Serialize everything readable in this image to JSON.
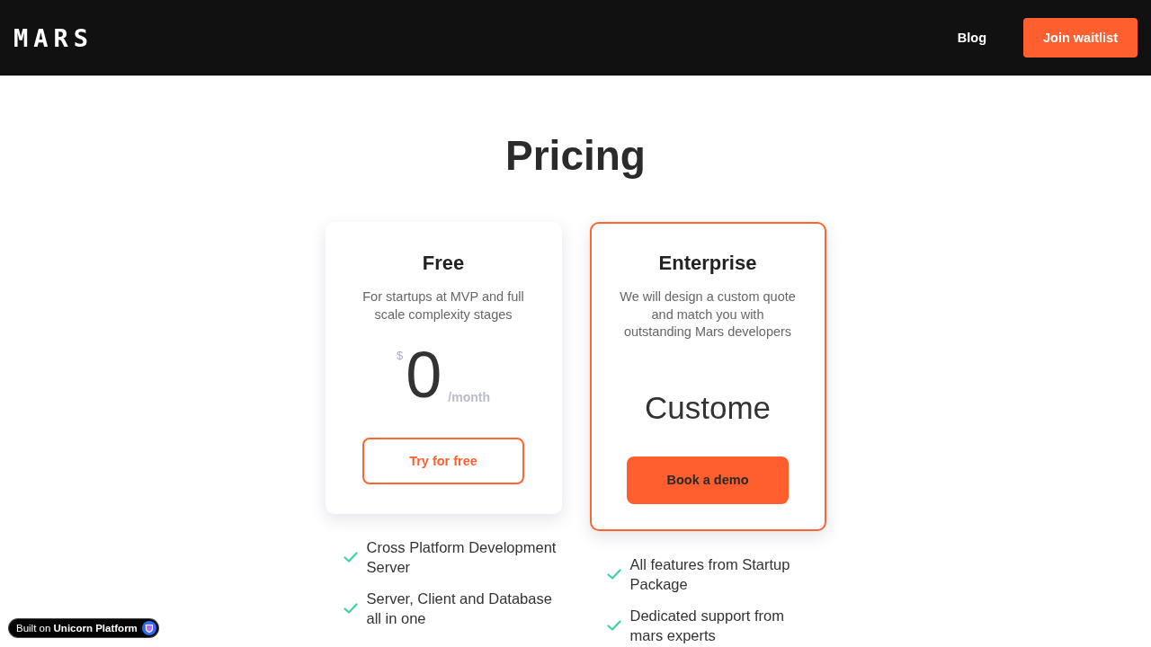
{
  "header": {
    "logo": "MARS",
    "nav": [
      "Blog"
    ],
    "cta": "Join waitlist"
  },
  "title": "Pricing",
  "plans": [
    {
      "kind": "price",
      "highlighted": false,
      "name": "Free",
      "description": "For startups at MVP and full scale complexity stages",
      "currency": "$",
      "price": "0",
      "period": "/month",
      "button": {
        "kind": "outline",
        "label": "Try for free"
      },
      "features": [
        "Cross Platform Development Server",
        "Server, Client and Database all in one"
      ]
    },
    {
      "kind": "custom",
      "highlighted": true,
      "name": "Enterprise",
      "description": "We will design a custom quote and match you with outstanding Mars developers",
      "price": "Custome",
      "button": {
        "kind": "filled",
        "label": "Book a demo"
      },
      "features": [
        "All features from Startup Package",
        "Dedicated support from mars experts"
      ]
    }
  ],
  "badge": "Built on **Unicorn Platform**"
}
